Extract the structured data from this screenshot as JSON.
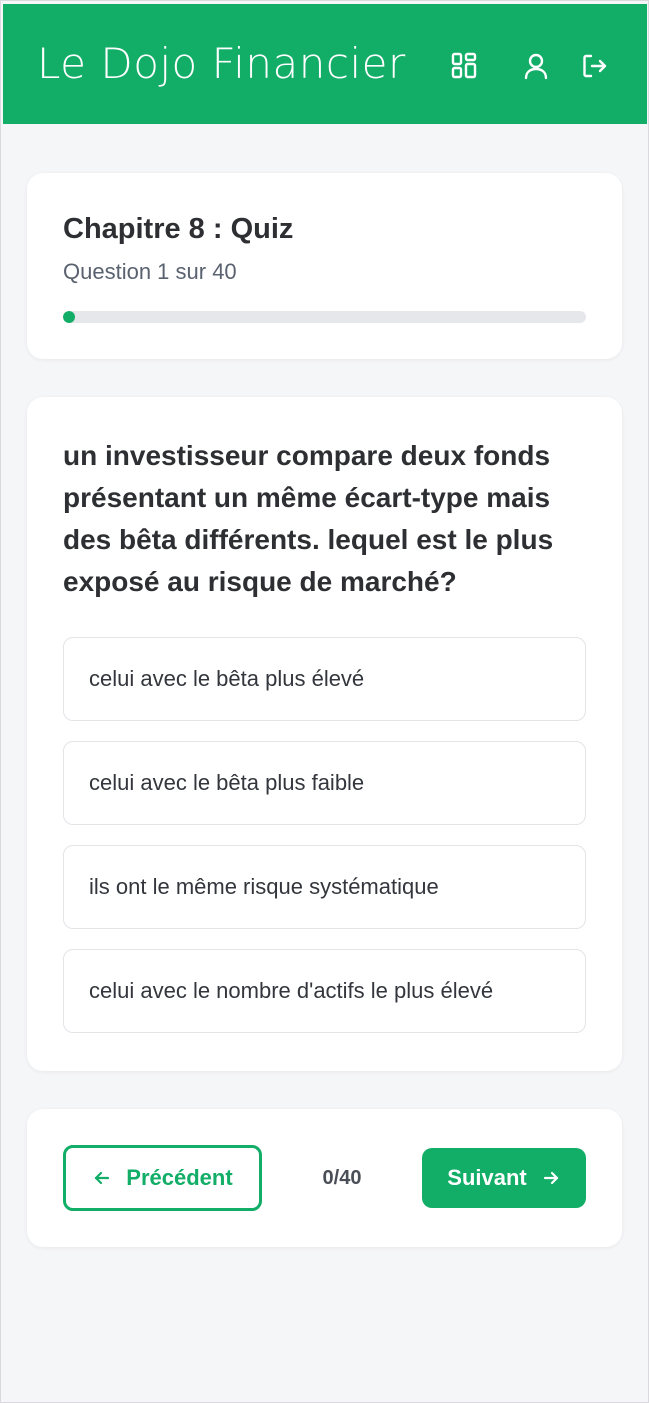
{
  "header": {
    "brand": "Le Dojo Financier",
    "icons": [
      "grid-icon",
      "user-icon",
      "logout-icon"
    ],
    "color": "#12ad67"
  },
  "progress": {
    "title": "Chapitre 8 : Quiz",
    "subtitle": "Question 1 sur 40",
    "fraction": 0.01
  },
  "question": {
    "text": "un investisseur compare deux fonds présentant un même écart-type mais des bêta différents. lequel est le plus exposé au risque de marché?",
    "options": [
      "celui avec le bêta plus élevé",
      "celui avec le bêta plus faible",
      "ils ont le même risque systématique",
      "celui avec le nombre d'actifs le plus élevé"
    ]
  },
  "nav": {
    "prev_label": "Précédent",
    "counter": "0/40",
    "next_label": "Suivant"
  }
}
